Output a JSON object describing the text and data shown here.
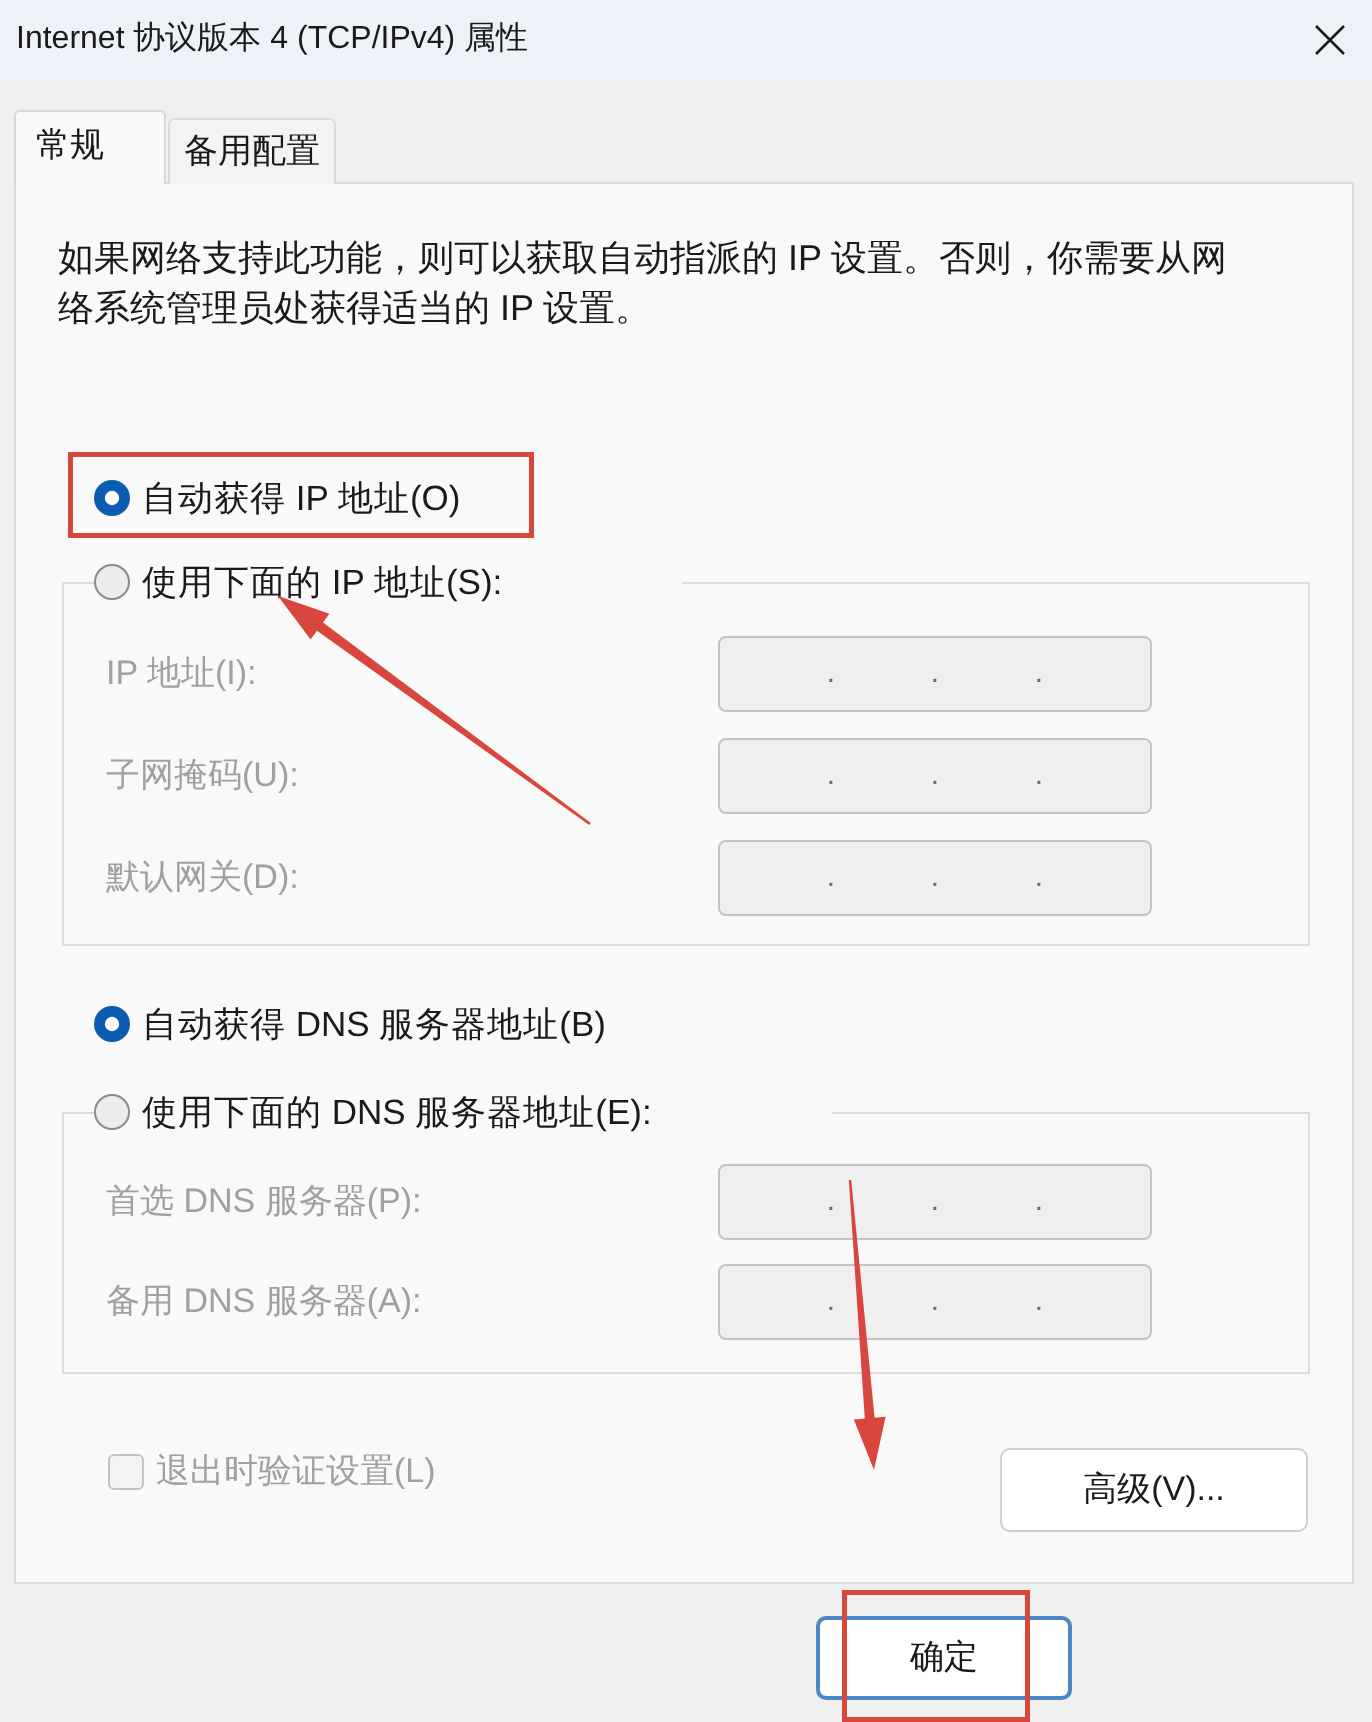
{
  "window": {
    "title": "Internet 协议版本 4 (TCP/IPv4) 属性"
  },
  "tabs": [
    {
      "label": "常规",
      "selected": true
    },
    {
      "label": "备用配置",
      "selected": false
    }
  ],
  "description": "如果网络支持此功能，则可以获取自动指派的 IP 设置。否则，你需要从网络系统管理员处获得适当的 IP 设置。",
  "ip_options": [
    {
      "label": "自动获得 IP 地址(O)",
      "selected": true
    },
    {
      "label": "使用下面的 IP 地址(S):",
      "selected": false
    }
  ],
  "ip_fields": [
    {
      "label": "IP 地址(I):",
      "separators": [
        ".",
        ".",
        "."
      ],
      "disabled": true
    },
    {
      "label": "子网掩码(U):",
      "separators": [
        ".",
        ".",
        "."
      ],
      "disabled": true
    },
    {
      "label": "默认网关(D):",
      "separators": [
        ".",
        ".",
        "."
      ],
      "disabled": true
    }
  ],
  "dns_options": [
    {
      "label": "自动获得 DNS 服务器地址(B)",
      "selected": true
    },
    {
      "label": "使用下面的 DNS 服务器地址(E):",
      "selected": false
    }
  ],
  "dns_fields": [
    {
      "label": "首选 DNS 服务器(P):",
      "separators": [
        ".",
        ".",
        "."
      ],
      "disabled": true
    },
    {
      "label": "备用 DNS 服务器(A):",
      "separators": [
        ".",
        ".",
        "."
      ],
      "disabled": true
    }
  ],
  "validate_on_exit": {
    "label": "退出时验证设置(L)",
    "checked": false,
    "disabled": true
  },
  "advanced_button": {
    "label": "高级(V)..."
  },
  "ok_button": {
    "label": "确定"
  },
  "annotations": [
    {
      "kind": "box"
    },
    {
      "kind": "arrow"
    },
    {
      "kind": "arrow"
    },
    {
      "kind": "box"
    }
  ]
}
